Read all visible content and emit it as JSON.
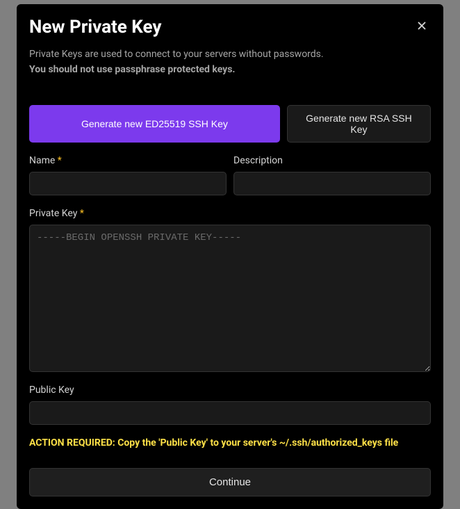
{
  "modal": {
    "title": "New Private Key",
    "intro_line1": "Private Keys are used to connect to your servers without passwords.",
    "intro_line2": "You should not use passphrase protected keys."
  },
  "buttons": {
    "generate_ed25519": "Generate new ED25519 SSH Key",
    "generate_rsa": "Generate new RSA SSH Key",
    "continue": "Continue"
  },
  "form": {
    "name_label": "Name",
    "description_label": "Description",
    "private_key_label": "Private Key",
    "private_key_placeholder": "-----BEGIN OPENSSH PRIVATE KEY-----",
    "public_key_label": "Public Key",
    "required_star": "*"
  },
  "action_required": "ACTION REQUIRED: Copy the 'Public Key' to your server's ~/.ssh/authorized_keys file"
}
